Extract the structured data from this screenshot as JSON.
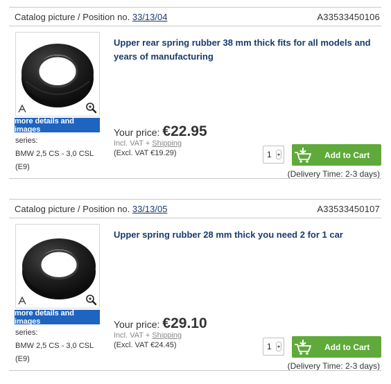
{
  "items": [
    {
      "header_prefix": "Catalog picture / Position no.",
      "position_no": "33/13/04",
      "article_no": "A33533450106",
      "title": "Upper rear spring rubber 38 mm thick fits for all models and years of manufacturing",
      "more_button": "more details and images",
      "series_label": "series:",
      "series_model": "BMW 2,5 CS - 3,0 CSL",
      "series_code": "(E9)",
      "price_label": "Your price:",
      "price": "€22.95",
      "incl_vat": "Incl. VAT + ",
      "shipping": "Shipping",
      "excl_vat": "(Excl. VAT €19.29)",
      "quantity": "1",
      "add_to_cart": "Add to Cart",
      "delivery": "(Delivery Time: 2-3 days)"
    },
    {
      "header_prefix": "Catalog picture / Position no.",
      "position_no": "33/13/05",
      "article_no": "A33533450107",
      "title": "Upper spring rubber 28 mm thick you need 2 for 1 car",
      "more_button": "more details and images",
      "series_label": "series:",
      "series_model": "BMW 2,5 CS - 3,0 CSL",
      "series_code": "(E9)",
      "price_label": "Your price:",
      "price": "€29.10",
      "incl_vat": "Incl. VAT + ",
      "shipping": "Shipping",
      "excl_vat": "(Excl. VAT €24.45)",
      "quantity": "1",
      "add_to_cart": "Add to Cart",
      "delivery": "(Delivery Time: 2-3 days)"
    }
  ],
  "icons": {
    "image": "spring-rubber-photo",
    "pen": "pen-icon",
    "zoom": "magnifier-icon",
    "cart": "cart-icon",
    "spinner": "stepper-icon"
  },
  "colors": {
    "title": "#1a3a6a",
    "button_blue": "#1e64c0",
    "cart_green": "#5faa3a"
  }
}
